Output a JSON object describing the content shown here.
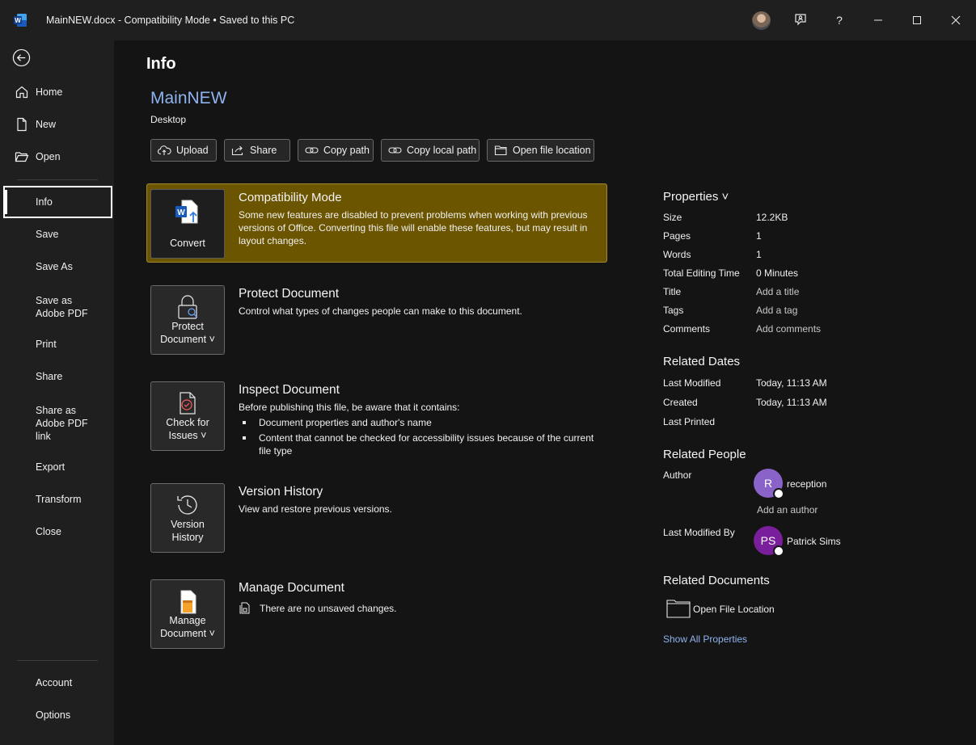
{
  "window": {
    "title": "MainNEW.docx  -  Compatibility Mode  •  Saved to this PC",
    "app_icon": "word-icon",
    "controls": [
      "coauthoring-icon",
      "help-icon",
      "minimize-icon",
      "maximize-icon",
      "close-icon"
    ],
    "help_glyph": "?"
  },
  "nav": {
    "top_items": [
      "Home",
      "New",
      "Open"
    ],
    "middle_items": [
      "Info",
      "Save",
      "Save As",
      "Save as Adobe PDF",
      "Print",
      "Share",
      "Share as Adobe PDF link",
      "Export",
      "Transform",
      "Close"
    ],
    "bottom_items": [
      "Account",
      "Options"
    ],
    "active": "Info"
  },
  "page": {
    "title": "Info",
    "doc_name": "MainNEW",
    "doc_location": "Desktop"
  },
  "actions": [
    "Upload",
    "Share",
    "Copy path",
    "Copy local path",
    "Open file location"
  ],
  "sections": {
    "compat": {
      "tile_label": "Convert",
      "title": "Compatibility Mode",
      "desc": "Some new features are disabled to prevent problems when working with previous versions of Office. Converting this file will enable these features, but may result in layout changes.",
      "panel_color": "#6b5500"
    },
    "protect": {
      "tile_label_1": "Protect",
      "tile_label_2": "Document ˅",
      "title": "Protect Document",
      "desc": "Control what types of changes people can make to this document."
    },
    "inspect": {
      "tile_label_1": "Check for",
      "tile_label_2": "Issues ˅",
      "title": "Inspect Document",
      "desc": "Before publishing this file, be aware that it contains:",
      "bullets": [
        "Document properties and author's name",
        "Content that cannot be checked for accessibility issues because of the current file type"
      ]
    },
    "version": {
      "tile_label_1": "Version",
      "tile_label_2": "History",
      "title": "Version History",
      "desc": "View and restore previous versions."
    },
    "manage": {
      "tile_label_1": "Manage",
      "tile_label_2": "Document ˅",
      "title": "Manage Document",
      "desc": "There are no unsaved changes."
    }
  },
  "properties": {
    "header": "Properties ˅",
    "rows": [
      {
        "label": "Size",
        "value": "12.2KB"
      },
      {
        "label": "Pages",
        "value": "1"
      },
      {
        "label": "Words",
        "value": "1"
      },
      {
        "label": "Total Editing Time",
        "value": "0 Minutes"
      },
      {
        "label": "Title",
        "value": "Add a title"
      },
      {
        "label": "Tags",
        "value": "Add a tag"
      },
      {
        "label": "Comments",
        "value": "Add comments"
      }
    ]
  },
  "related_dates": {
    "header": "Related Dates",
    "rows": [
      {
        "label": "Last Modified",
        "value": "Today, 11:13 AM"
      },
      {
        "label": "Created",
        "value": "Today, 11:13 AM"
      },
      {
        "label": "Last Printed",
        "value": ""
      }
    ]
  },
  "related_people": {
    "header": "Related People",
    "author_label": "Author",
    "author_initial": "R",
    "author_name": "reception",
    "author_color": "#8a63c8",
    "add_author": "Add an author",
    "modified_label": "Last Modified By",
    "modified_initials": "PS",
    "modified_name": "Patrick Sims",
    "modified_color": "#7a1f9c"
  },
  "related_documents": {
    "header": "Related Documents",
    "open_location": "Open File Location",
    "show_all": "Show All Properties"
  }
}
